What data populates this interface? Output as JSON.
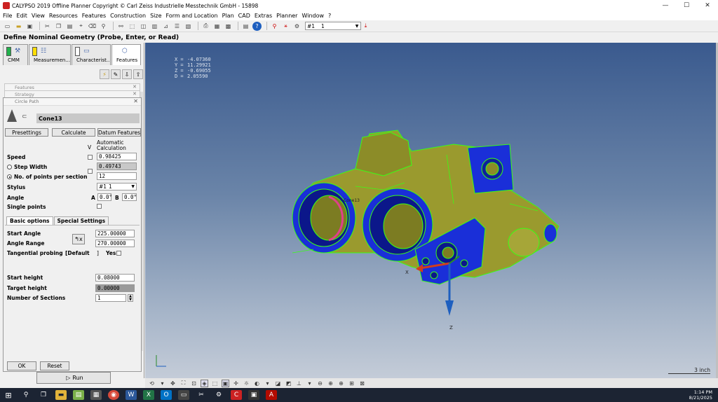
{
  "window": {
    "title": "CALYPSO 2019 Offline Planner Copyright © Carl Zeiss Industrielle Messtechnik GmbH - 15898",
    "minimize": "—",
    "maximize": "☐",
    "close": "✕"
  },
  "menu": [
    "File",
    "Edit",
    "View",
    "Resources",
    "Features",
    "Construction",
    "Size",
    "Form and Location",
    "Plan",
    "CAD",
    "Extras",
    "Planner",
    "Window",
    "?"
  ],
  "toolbar": {
    "stylus_combo": {
      "col1": "#1",
      "col2": "1"
    }
  },
  "header": {
    "title": "Define Nominal Geometry (Probe, Enter, or Read)"
  },
  "tabs": [
    {
      "label": "CMM",
      "color": "#22b14c"
    },
    {
      "label": "Measuremen...",
      "color": "#ffdd00"
    },
    {
      "label": "Characterist...",
      "color": "#ffffff"
    },
    {
      "label": "Features",
      "color": ""
    }
  ],
  "collapsed_panels": [
    "Features",
    "Strategy"
  ],
  "dialog": {
    "title": "Circle Path",
    "feature_name": "Cone13",
    "buttons": {
      "presettings": "Presettings",
      "calculate": "Calculate",
      "datum": "Datum Features"
    },
    "col_v": "V",
    "auto_calc": "Automatic Calculation",
    "speed": {
      "label": "Speed",
      "value": "0.98425"
    },
    "step_width": {
      "label": "Step Width",
      "value": "0.49743"
    },
    "points_per_section": {
      "label": "No. of points per section",
      "value": "12"
    },
    "stylus": {
      "label": "Stylus",
      "col1": "#1",
      "col2": "1"
    },
    "angle": {
      "label": "Angle",
      "a_label": "A",
      "a_value": "0.0°",
      "b_label": "B",
      "b_value": "0.0°"
    },
    "single_points": {
      "label": "Single points"
    },
    "subtabs": [
      "Basic options",
      "Special Settings"
    ],
    "start_angle": {
      "label": "Start Angle",
      "value": "225.00000"
    },
    "angle_range": {
      "label": "Angle Range",
      "value": "270.00000"
    },
    "tangential": {
      "label": "Tangential probing",
      "default": "[Default",
      "bracket": "]",
      "yes": "Yes"
    },
    "start_height": {
      "label": "Start height",
      "value": "0.08000"
    },
    "target_height": {
      "label": "Target height",
      "value": "0.00000"
    },
    "sections": {
      "label": "Number of Sections",
      "value": "1"
    },
    "ok": "OK",
    "reset": "Reset"
  },
  "run_label": "Run",
  "viewport": {
    "coords": [
      {
        "k": "X =",
        "v": "-4.07360"
      },
      {
        "k": "Y =",
        "v": "11.29921"
      },
      {
        "k": "Z =",
        "v": "-0.69055"
      },
      {
        "k": "D =",
        "v": "2.05590"
      }
    ],
    "part_label": "Cone13",
    "axis_x": "X",
    "axis_z": "Z",
    "scale": "3 inch",
    "colors": {
      "body": "#9a9a2e",
      "edges": "#39ff14",
      "faces": "#1a2fd8"
    }
  },
  "taskbar": {
    "time": "1:14 PM",
    "date": "8/21/2025"
  }
}
